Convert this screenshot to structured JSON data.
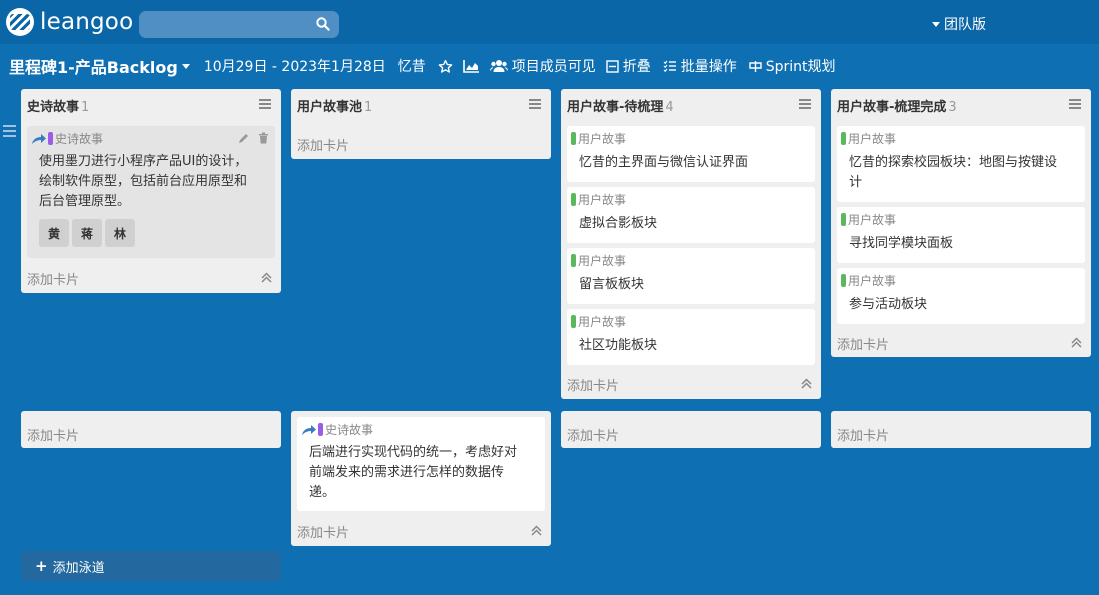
{
  "nav": {
    "logo_text": "leangoo",
    "search_placeholder": "",
    "team_label": "团队版"
  },
  "board": {
    "title": "里程碑1-产品Backlog",
    "date_range": "10月29日 - 2023年1月28日",
    "owner": "忆昔",
    "visibility": "项目成员可见",
    "fold": "折叠",
    "batch": "批量操作",
    "sprint": "Sprint规划"
  },
  "common": {
    "add_card": "添加卡片",
    "add_lane": "添加泳道"
  },
  "lists": [
    {
      "title": "史诗故事",
      "count": "1"
    },
    {
      "title": "用户故事池",
      "count": "1"
    },
    {
      "title": "用户故事-待梳理",
      "count": "4"
    },
    {
      "title": "用户故事-梳理完成",
      "count": "3"
    }
  ],
  "cards": {
    "epic1": {
      "tag": "史诗故事",
      "line1": "使用墨刀进行小程序产品UI的设计，",
      "line2": "绘制软件原型，包括前台应用原型和",
      "line3": "后台管理原型。",
      "members": [
        "黄",
        "蒋",
        "林"
      ]
    },
    "todo1": {
      "tag": "用户故事",
      "text": "忆昔的主界面与微信认证界面"
    },
    "todo2": {
      "tag": "用户故事",
      "text": "虚拟合影板块"
    },
    "todo3": {
      "tag": "用户故事",
      "text": "留言板板块"
    },
    "todo4": {
      "tag": "用户故事",
      "text": "社区功能板块"
    },
    "done1": {
      "tag": "用户故事",
      "line1": "忆昔的探索校园板块：地图与按键设",
      "line2": "计"
    },
    "done2": {
      "tag": "用户故事",
      "text": "寻找同学模块面板"
    },
    "done3": {
      "tag": "用户故事",
      "text": "参与活动板块"
    },
    "epic2": {
      "tag": "史诗故事",
      "line1": "后端进行实现代码的统一，考虑好对",
      "line2": "前端发来的需求进行怎样的数据传",
      "line3": "递。"
    }
  },
  "colors": {
    "background": "#0f6fb3",
    "nav": "#0b66a8",
    "story_tag": "#5cb85c",
    "epic_tag": "#9b5de5",
    "lane_button": "#2369a0"
  }
}
